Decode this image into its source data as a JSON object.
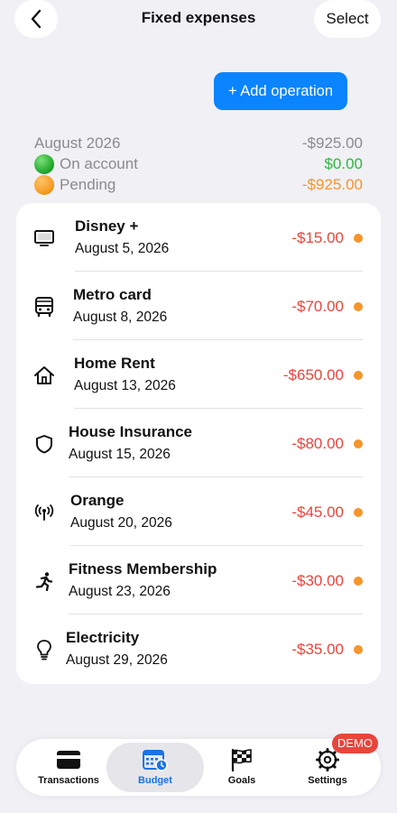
{
  "header": {
    "title": "Fixed expenses",
    "select_label": "Select"
  },
  "actions": {
    "add_label": "+ Add operation"
  },
  "summary": {
    "period": "August 2026",
    "total": "-$925.00",
    "on_account_label": "On account",
    "on_account_value": "$0.00",
    "pending_label": "Pending",
    "pending_value": "-$925.00"
  },
  "expenses": [
    {
      "name": "Disney +",
      "date": "August 5, 2026",
      "amount": "-$15.00",
      "icon": "tv-icon"
    },
    {
      "name": "Metro card",
      "date": "August 8, 2026",
      "amount": "-$70.00",
      "icon": "bus-icon"
    },
    {
      "name": "Home Rent",
      "date": "August 13, 2026",
      "amount": "-$650.00",
      "icon": "house-icon"
    },
    {
      "name": "House Insurance",
      "date": "August 15, 2026",
      "amount": "-$80.00",
      "icon": "shield-icon"
    },
    {
      "name": "Orange",
      "date": "August 20, 2026",
      "amount": "-$45.00",
      "icon": "antenna-icon"
    },
    {
      "name": "Fitness Membership",
      "date": "August 23, 2026",
      "amount": "-$30.00",
      "icon": "runner-icon"
    },
    {
      "name": "Electricity",
      "date": "August 29, 2026",
      "amount": "-$35.00",
      "icon": "lightbulb-icon"
    }
  ],
  "tabs": {
    "transactions": "Transactions",
    "budget": "Budget",
    "goals": "Goals",
    "settings": "Settings",
    "demo_badge": "DEMO",
    "active": "budget"
  },
  "colors": {
    "accent": "#0a84ff",
    "negative": "#e8453c",
    "positive": "#2db83d",
    "pending": "#f5952a"
  }
}
